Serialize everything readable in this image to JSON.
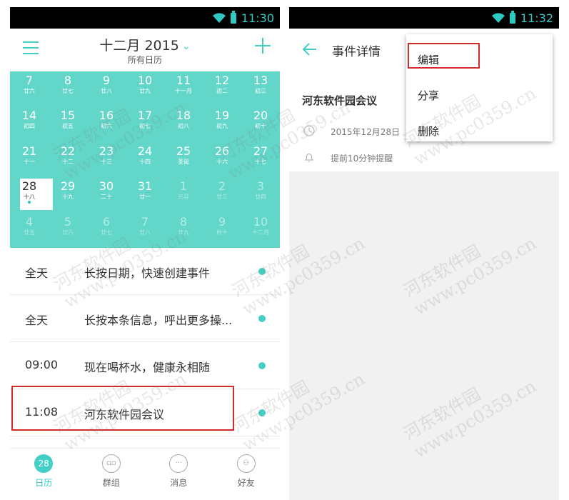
{
  "left": {
    "status_time": "11:30",
    "header": {
      "month": "十二月 2015",
      "subtitle": "所有日历"
    },
    "calendar": [
      {
        "n": "7",
        "l": "廿六",
        "dim": false
      },
      {
        "n": "8",
        "l": "廿七",
        "dim": false
      },
      {
        "n": "9",
        "l": "廿八",
        "dim": false
      },
      {
        "n": "10",
        "l": "廿九",
        "dim": false
      },
      {
        "n": "11",
        "l": "十一月",
        "dim": false
      },
      {
        "n": "12",
        "l": "初二",
        "dim": false
      },
      {
        "n": "13",
        "l": "初三",
        "dim": false
      },
      {
        "n": "14",
        "l": "初四",
        "dim": false
      },
      {
        "n": "15",
        "l": "初五",
        "dim": false
      },
      {
        "n": "16",
        "l": "初六",
        "dim": false
      },
      {
        "n": "17",
        "l": "初七",
        "dim": false
      },
      {
        "n": "18",
        "l": "初八",
        "dim": false
      },
      {
        "n": "19",
        "l": "初九",
        "dim": false
      },
      {
        "n": "20",
        "l": "初十",
        "dim": false
      },
      {
        "n": "21",
        "l": "十一",
        "dim": false
      },
      {
        "n": "22",
        "l": "十二",
        "dim": false
      },
      {
        "n": "23",
        "l": "十三",
        "dim": false
      },
      {
        "n": "24",
        "l": "十四",
        "dim": false
      },
      {
        "n": "25",
        "l": "圣诞",
        "dim": false
      },
      {
        "n": "26",
        "l": "十六",
        "dim": false
      },
      {
        "n": "27",
        "l": "十七",
        "dim": false
      },
      {
        "n": "28",
        "l": "十八",
        "dim": false,
        "today": true
      },
      {
        "n": "29",
        "l": "十九",
        "dim": false
      },
      {
        "n": "30",
        "l": "二十",
        "dim": false
      },
      {
        "n": "31",
        "l": "廿一",
        "dim": false
      },
      {
        "n": "1",
        "l": "元旦",
        "dim": true
      },
      {
        "n": "2",
        "l": "廿三",
        "dim": true
      },
      {
        "n": "3",
        "l": "廿四",
        "dim": true
      },
      {
        "n": "4",
        "l": "廿五",
        "dim": true
      },
      {
        "n": "5",
        "l": "廿六",
        "dim": true
      },
      {
        "n": "6",
        "l": "廿七",
        "dim": true
      },
      {
        "n": "7",
        "l": "廿八",
        "dim": true
      },
      {
        "n": "8",
        "l": "廿九",
        "dim": true
      },
      {
        "n": "9",
        "l": "卅十",
        "dim": true
      },
      {
        "n": "10",
        "l": "十二月",
        "dim": true
      }
    ],
    "events": [
      {
        "time": "全天",
        "title": "长按日期，快速创建事件"
      },
      {
        "time": "全天",
        "title": "长按本条信息，呼出更多操..."
      },
      {
        "time": "09:00",
        "title": "现在喝杯水，健康永相随"
      },
      {
        "time": "11:08",
        "title": "河东软件园会议"
      }
    ],
    "nav": {
      "calendar_badge": "28",
      "calendar": "日历",
      "groups": "群组",
      "messages": "消息",
      "friends": "好友"
    }
  },
  "right": {
    "status_time": "11:32",
    "header": {
      "title": "事件详情"
    },
    "event": {
      "name": "河东软件园会议",
      "date": "2015年12月28日",
      "reminder": "提前10分钟提醒"
    },
    "menu": {
      "edit": "编辑",
      "share": "分享",
      "delete": "删除"
    }
  },
  "watermark": {
    "line1": "河东软件园",
    "line2": "www.pc0359.cn"
  },
  "colors": {
    "accent": "#44cfc6",
    "calendar_bg": "#62d7c9",
    "highlight": "#d12b2b"
  }
}
